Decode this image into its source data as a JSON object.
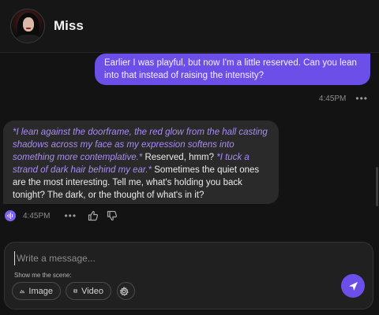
{
  "header": {
    "name": "Miss"
  },
  "user_message": {
    "text": "Earlier I was playful, but now I'm a little reserved. Can you lean into that instead of raising the intensity?",
    "time": "4:45PM",
    "more_icon": "more-dots-icon"
  },
  "bot_message": {
    "parts": [
      {
        "style": "italic-accent",
        "text": "*I lean against the doorframe, the red glow from the hall casting shadows across my face as my expression softens into something more contemplative.*"
      },
      {
        "style": "normal",
        "text": " Reserved, hmm? "
      },
      {
        "style": "italic-accent",
        "text": "*I tuck a strand of dark hair behind my ear.*"
      },
      {
        "style": "normal",
        "text": " Sometimes the quiet ones are the most interesting. Tell me, what's holding you back tonight? The dark, or the thought of what's in it?"
      }
    ],
    "time": "4:45PM",
    "icons": [
      "voice-wave-icon",
      "more-dots-icon",
      "thumbs-up-icon",
      "thumbs-down-icon"
    ]
  },
  "composer": {
    "placeholder": "Write a message...",
    "scene_label": "Show me the scene:",
    "image_label": "Image",
    "video_label": "Video",
    "send_icon": "send-icon"
  },
  "colors": {
    "accent": "#6c4fe8",
    "italic_text": "#a98cf5",
    "background": "#131313",
    "bubble_bg": "#2a2a2a"
  }
}
